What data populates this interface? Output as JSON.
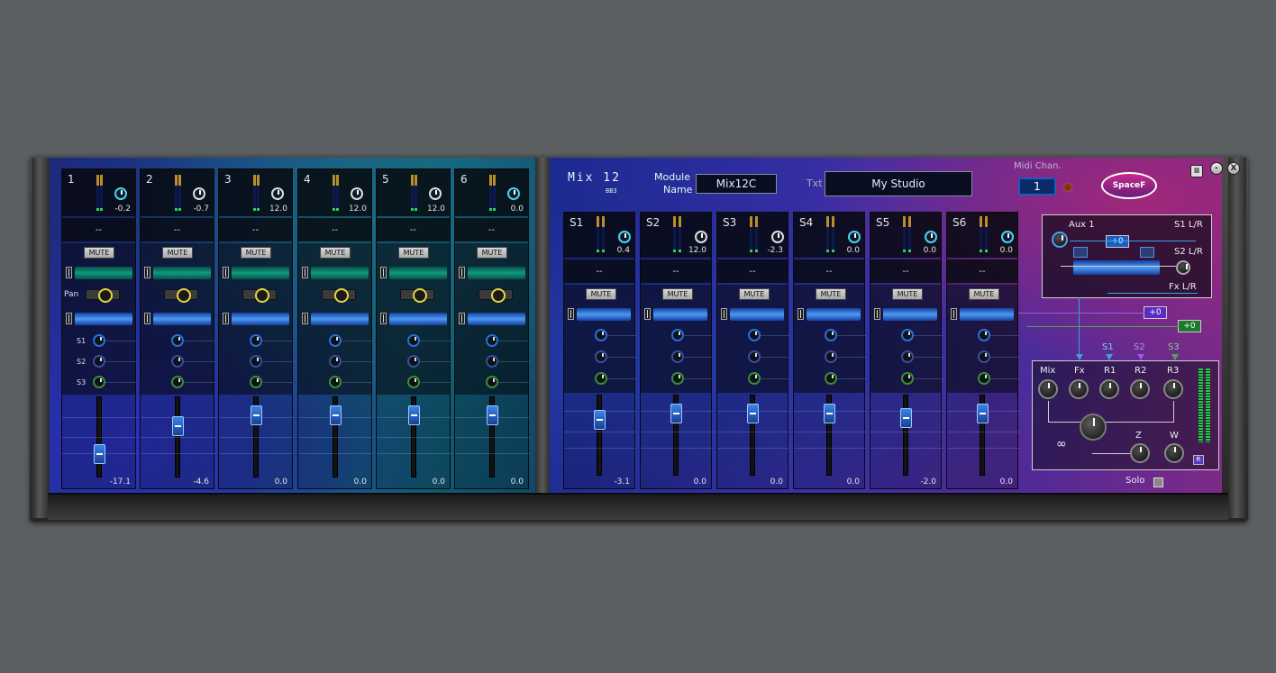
{
  "left_channels": [
    {
      "num": "1",
      "gain": "-0.2",
      "gain_color": "cyan",
      "route": "--",
      "mute": "MUTE",
      "fader": "-17.1",
      "fader_pos": 0.22
    },
    {
      "num": "2",
      "gain": "-0.7",
      "gain_color": "white",
      "route": "--",
      "mute": "MUTE",
      "fader": "-4.6",
      "fader_pos": 0.68
    },
    {
      "num": "3",
      "gain": "12.0",
      "gain_color": "white",
      "route": "--",
      "mute": "MUTE",
      "fader": "0.0",
      "fader_pos": 0.85
    },
    {
      "num": "4",
      "gain": "12.0",
      "gain_color": "white",
      "route": "--",
      "mute": "MUTE",
      "fader": "0.0",
      "fader_pos": 0.85
    },
    {
      "num": "5",
      "gain": "12.0",
      "gain_color": "white",
      "route": "--",
      "mute": "MUTE",
      "fader": "0.0",
      "fader_pos": 0.85
    },
    {
      "num": "6",
      "gain": "0.0",
      "gain_color": "cyan",
      "route": "--",
      "mute": "MUTE",
      "fader": "0.0",
      "fader_pos": 0.85
    }
  ],
  "left_labels": {
    "pan": "Pan",
    "s1": "S1",
    "s2": "S2",
    "s3": "S3"
  },
  "module": {
    "title": "Mix 12",
    "subtitle": "BB3",
    "module_name_label": "Module\nName",
    "module_name_line1": "Module",
    "module_name_line2": "Name",
    "module_name_value": "Mix12C",
    "txt_label": "Txt",
    "txt_value": "My Studio",
    "midi_label": "Midi Chan.",
    "midi_value": "1",
    "logo": "SpaceF"
  },
  "window_buttons": {
    "min": "-",
    "close": "X"
  },
  "stereo_channels": [
    {
      "num": "S1",
      "gain": "0.4",
      "gain_color": "cyan",
      "route": "--",
      "mute": "MUTE",
      "fader": "-3.1",
      "fader_pos": 0.75
    },
    {
      "num": "S2",
      "gain": "12.0",
      "gain_color": "white",
      "route": "--",
      "mute": "MUTE",
      "fader": "0.0",
      "fader_pos": 0.85
    },
    {
      "num": "S3",
      "gain": "-2.3",
      "gain_color": "white",
      "route": "--",
      "mute": "MUTE",
      "fader": "0.0",
      "fader_pos": 0.85
    },
    {
      "num": "S4",
      "gain": "0.0",
      "gain_color": "cyan",
      "route": "--",
      "mute": "MUTE",
      "fader": "0.0",
      "fader_pos": 0.85
    },
    {
      "num": "S5",
      "gain": "0.0",
      "gain_color": "cyan",
      "route": "--",
      "mute": "MUTE",
      "fader": "-2.0",
      "fader_pos": 0.78
    },
    {
      "num": "S6",
      "gain": "0.0",
      "gain_color": "cyan",
      "route": "--",
      "mute": "MUTE",
      "fader": "0.0",
      "fader_pos": 0.85
    }
  ],
  "aux": {
    "label": "Aux 1",
    "s1_lr": "S1 L/R",
    "s2_lr": "S2 L/R",
    "fx_lr": "Fx L/R",
    "level": "+0"
  },
  "returns": {
    "tag_purple": "+0",
    "tag_green": "+0",
    "s1": "S1",
    "s2": "S2",
    "s3": "S3",
    "mix": "Mix",
    "fx": "Fx",
    "r1": "R1",
    "r2": "R2",
    "r3": "R3",
    "z": "Z",
    "w": "W",
    "r_button": "R",
    "solo": "Solo"
  }
}
